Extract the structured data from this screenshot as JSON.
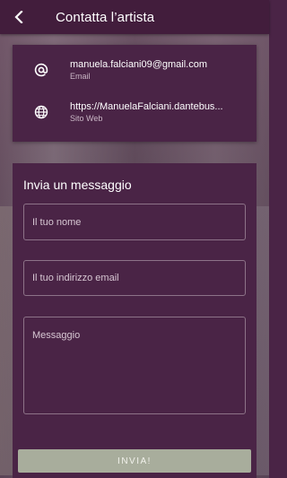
{
  "header": {
    "title": "Contatta l’artista",
    "back_icon": "back-arrow-icon"
  },
  "contacts": [
    {
      "icon": "at-sign-icon",
      "value": "manuela.falciani09@gmail.com",
      "label": "Email"
    },
    {
      "icon": "globe-icon",
      "value": "https://ManuelaFalciani.dantebus...",
      "label": "Sito Web"
    }
  ],
  "form": {
    "title": "Invia un messaggio",
    "name_placeholder": "Il tuo nome",
    "email_placeholder": "Il tuo indirizzo email",
    "message_placeholder": "Messaggio",
    "submit_label": "INVIA!"
  },
  "colors": {
    "panel": "#4a2446",
    "appbar": "#421d3c",
    "button": "#a8ad9c"
  }
}
